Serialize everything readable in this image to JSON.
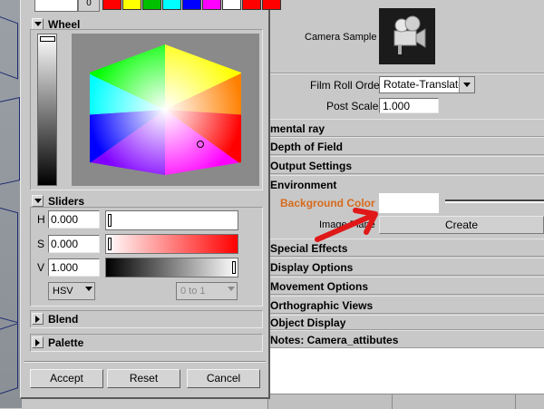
{
  "color_chooser": {
    "top_field_value": "",
    "top_spinner": "0",
    "palette_colors": [
      "#ff0000",
      "#ffff00",
      "#00c000",
      "#00ffff",
      "#0000ff",
      "#ff00ff",
      "#ffffff",
      "#ff0000",
      "#ff0000"
    ],
    "wheel_section": {
      "label": "Wheel"
    },
    "sliders_section": {
      "label": "Sliders",
      "rows": [
        {
          "label": "H",
          "value": "0.000",
          "level": 0.0
        },
        {
          "label": "S",
          "value": "0.000",
          "level": 0.0
        },
        {
          "label": "V",
          "value": "1.000",
          "level": 1.0
        }
      ],
      "mode_dropdown": "HSV",
      "range_dropdown": "0 to 1"
    },
    "blend_section": {
      "label": "Blend"
    },
    "palette_section": {
      "label": "Palette"
    },
    "buttons": {
      "accept": "Accept",
      "reset": "Reset",
      "cancel": "Cancel"
    }
  },
  "attribute_editor": {
    "camera_sample_label": "Camera Sample",
    "film_roll_order": {
      "label": "Film Roll Order",
      "value": "Rotate-Translate"
    },
    "post_scale": {
      "label": "Post Scale",
      "value": "1.000"
    },
    "sections": [
      "mental ray",
      "Depth of Field",
      "Output Settings",
      "Environment"
    ],
    "environment": {
      "background_color_label": "Background Color",
      "background_color": "#ffffff",
      "image_plane_label": "Image Plane",
      "create_button": "Create"
    },
    "sections_after": [
      "Special Effects",
      "Display Options",
      "Movement Options",
      "Orthographic Views",
      "Object Display"
    ],
    "notes_label": "Notes:  Camera_attibutes",
    "accent_color": "#d86a1b",
    "arrow_color": "#e01818"
  }
}
